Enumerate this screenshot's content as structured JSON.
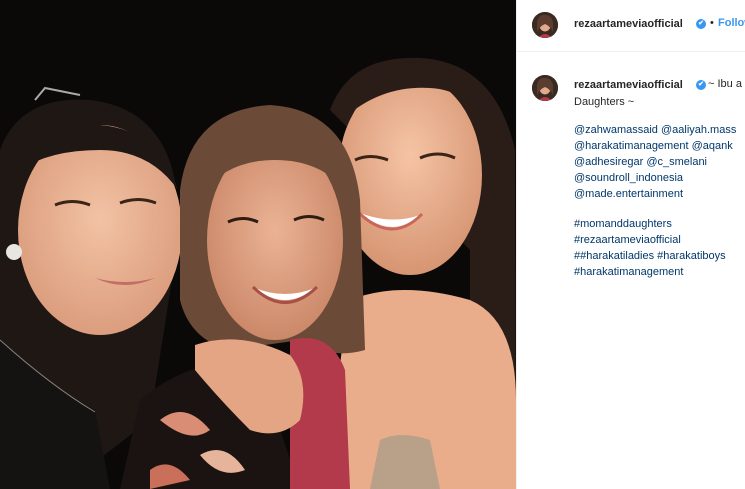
{
  "post": {
    "photo_alt": "Three women smiling together in a selfie at night"
  },
  "header": {
    "username": "rezaartameviaofficial",
    "verified_mark": "✔",
    "separator": "•",
    "follow_label": "Follow"
  },
  "caption": {
    "username": "rezaartameviaofficial",
    "verified_mark": "✔",
    "first_line": "~ Ibu a",
    "second_line": "Daughters ~",
    "mentions": [
      "@zahwamassaid @aaliyah.mass",
      "@harakatimanagement @aqank",
      "@adhesiregar @c_smelani",
      "@soundroll_indonesia",
      "@made.entertainment"
    ],
    "hashtags": [
      "#momanddaughters",
      "#rezaartameviaofficial",
      "##harakatiladies #harakatiboys",
      "#harakatimanagement"
    ]
  },
  "colors": {
    "link": "#00376b",
    "follow": "#3897f0",
    "text": "#262626",
    "border": "#efefef"
  },
  "icons": {
    "verified": "verified-badge-icon",
    "avatar": "profile-avatar"
  }
}
